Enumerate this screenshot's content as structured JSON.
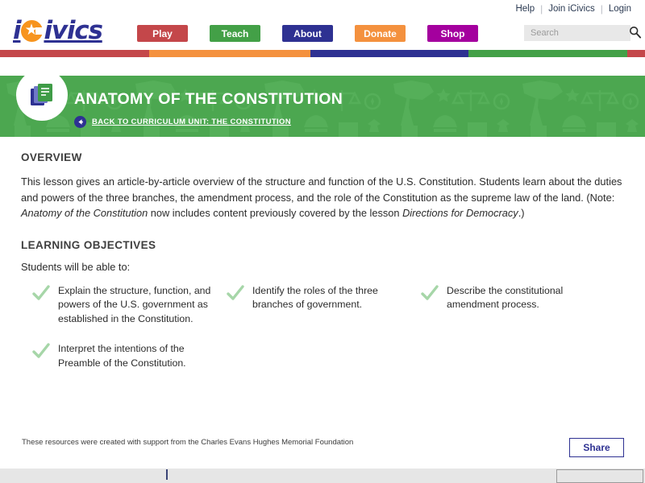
{
  "header": {
    "logo_text_1": "i",
    "logo_text_2": "ivics",
    "logo_icon": "star-icon",
    "utility_links": [
      {
        "label": "Help"
      },
      {
        "label": "Join iCivics"
      },
      {
        "label": "Login"
      }
    ],
    "separator": "|",
    "nav_buttons": [
      {
        "label": "Play",
        "color": "#c4474a"
      },
      {
        "label": "Teach",
        "color": "#43a047"
      },
      {
        "label": "About",
        "color": "#2e3192"
      },
      {
        "label": "Donate",
        "color": "#f4913e"
      },
      {
        "label": "Shop",
        "color": "#a4009e"
      }
    ],
    "search": {
      "placeholder": "Search",
      "value": "",
      "icon": "search-icon"
    },
    "stripe_colors": [
      "#c4474a",
      "#f4913e",
      "#2e3192",
      "#43a047",
      "#c4474a"
    ]
  },
  "hero": {
    "badge_icon": "documents-icon",
    "title": "ANATOMY OF THE CONSTITUTION",
    "back_link": "BACK TO CURRICULUM UNIT: THE CONSTITUTION",
    "back_icon": "arrow-left-icon",
    "background_color": "#4ca750",
    "pattern_icons": [
      "us-map-icon",
      "statue-of-liberty-icon",
      "scales-of-justice-icon",
      "liberty-bell-icon",
      "star-icon",
      "eagle-icon",
      "ballot-box-icon"
    ]
  },
  "overview": {
    "heading": "OVERVIEW",
    "paragraph_part1": "This lesson gives an article-by-article overview of the structure and function of the U.S. Constitution. Students learn about the duties and powers of the three branches, the amendment process, and the role of the Constitution as the supreme law of the land. (Note: ",
    "paragraph_italic1": "Anatomy of the Constitution",
    "paragraph_part2": " now includes content previously covered by the lesson ",
    "paragraph_italic2": "Directions for Democracy",
    "paragraph_part3": ".)"
  },
  "objectives": {
    "heading": "LEARNING OBJECTIVES",
    "lead": "Students will be able to:",
    "check_icon": "check-icon",
    "check_color": "#a6d6a8",
    "items": [
      {
        "text": "Explain the structure, function, and powers of the U.S. government as established in the Constitution."
      },
      {
        "text": "Identify the roles of the three branches of government."
      },
      {
        "text": "Describe the constitutional amendment process."
      },
      {
        "text": "Interpret the intentions of the Preamble of the Constitution."
      }
    ]
  },
  "footer": {
    "credit": "These resources were created with support from the Charles Evans Hughes Memorial Foundation",
    "share_label": "Share"
  }
}
